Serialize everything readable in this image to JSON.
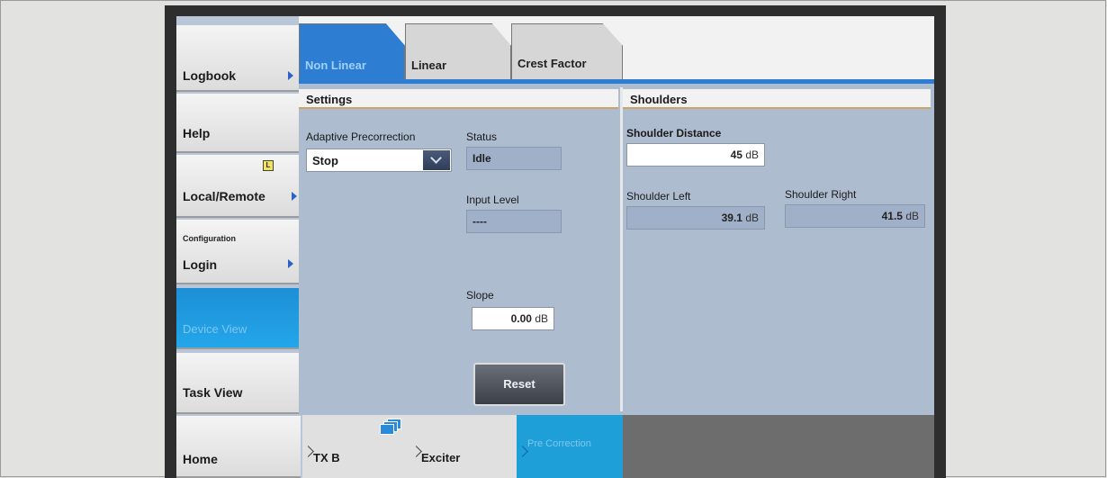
{
  "sidebar": {
    "logbook": "Logbook",
    "help": "Help",
    "local_remote": "Local/Remote",
    "local_badge": "L",
    "configuration": "Configuration",
    "login": "Login",
    "device_view": "Device View",
    "task_view": "Task View",
    "home": "Home"
  },
  "tabs": [
    "Non Linear",
    "Linear",
    "Crest Factor"
  ],
  "settings": {
    "header": "Settings",
    "adaptive_label": "Adaptive Precorrection",
    "adaptive_value": "Stop",
    "status_label": "Status",
    "status_value": "Idle",
    "input_level_label": "Input Level",
    "input_level_value": "----",
    "slope_label": "Slope",
    "slope_value": "0.00",
    "slope_unit": "dB",
    "reset_label": "Reset"
  },
  "shoulders": {
    "header": "Shoulders",
    "distance_label": "Shoulder Distance",
    "distance_value": "45",
    "distance_unit": "dB",
    "left_label": "Shoulder Left",
    "left_value": "39.1",
    "left_unit": "dB",
    "right_label": "Shoulder Right",
    "right_value": "41.5",
    "right_unit": "dB"
  },
  "breadcrumb": {
    "tx": "TX B",
    "exciter": "Exciter",
    "pre_correction": "Pre Correction"
  }
}
